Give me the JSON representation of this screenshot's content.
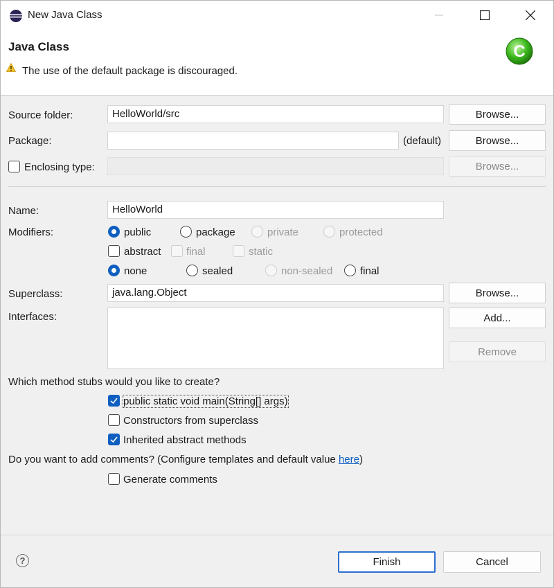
{
  "window": {
    "title": "New Java Class"
  },
  "header": {
    "title": "Java Class",
    "message": "The use of the default package is discouraged."
  },
  "source_folder": {
    "label": "Source folder:",
    "value": "HelloWorld/src",
    "browse": "Browse..."
  },
  "package": {
    "label": "Package:",
    "value": "",
    "default_text": "(default)",
    "browse": "Browse..."
  },
  "enclosing": {
    "label": "Enclosing type:",
    "value": "",
    "browse": "Browse...",
    "checked": false
  },
  "name": {
    "label": "Name:",
    "value": "HelloWorld"
  },
  "modifiers": {
    "label": "Modifiers:",
    "access": [
      "public",
      "package",
      "private",
      "protected"
    ],
    "flags": [
      "abstract",
      "final",
      "static"
    ],
    "sealing": [
      "none",
      "sealed",
      "non-sealed",
      "final"
    ],
    "selected_access": "public",
    "selected_sealing": "none"
  },
  "superclass": {
    "label": "Superclass:",
    "value": "java.lang.Object",
    "browse": "Browse..."
  },
  "interfaces": {
    "label": "Interfaces:",
    "add": "Add...",
    "remove": "Remove"
  },
  "stubs": {
    "question": "Which method stubs would you like to create?",
    "options": [
      {
        "label": "public static void main(String[] args)",
        "checked": true
      },
      {
        "label": "Constructors from superclass",
        "checked": false
      },
      {
        "label": "Inherited abstract methods",
        "checked": true
      }
    ]
  },
  "comments": {
    "question_prefix": "Do you want to add comments? (Configure templates and default value ",
    "link": "here",
    "question_suffix": ")",
    "generate_label": "Generate comments",
    "checked": false
  },
  "footer": {
    "help": "?",
    "finish": "Finish",
    "cancel": "Cancel"
  },
  "colors": {
    "accent": "#0f5fc0",
    "banner_icon": "#3cb81c",
    "warning": "#e8b400"
  }
}
